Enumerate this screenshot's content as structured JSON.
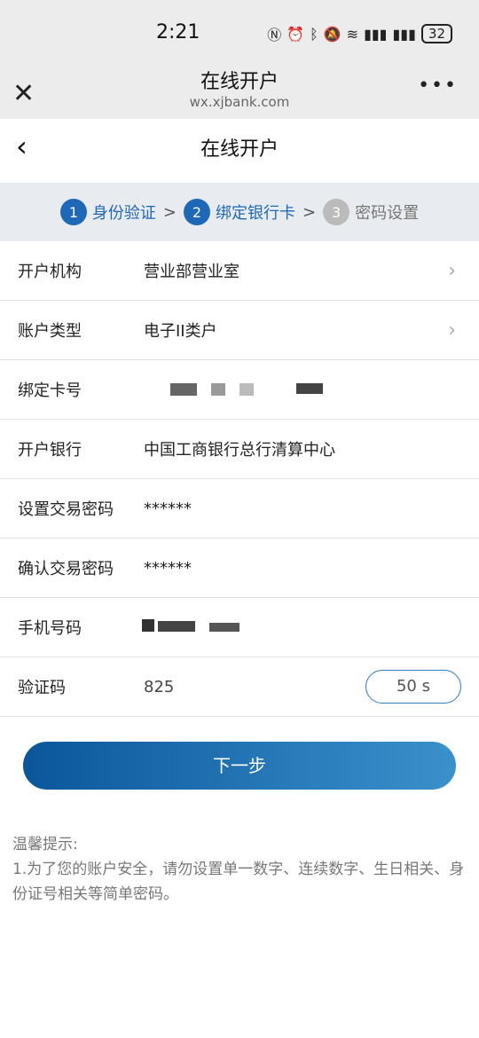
{
  "status": {
    "time": "2:21",
    "battery": "32"
  },
  "browser": {
    "title": "在线开户",
    "url": "wx.xjbank.com"
  },
  "page": {
    "title": "在线开户"
  },
  "steps": [
    {
      "num": "1",
      "label": "身份验证"
    },
    {
      "num": "2",
      "label": "绑定银行卡"
    },
    {
      "num": "3",
      "label": "密码设置"
    }
  ],
  "step_sep": ">",
  "form": {
    "institution": {
      "label": "开户机构",
      "value": "营业部营业室"
    },
    "account_type": {
      "label": "账户类型",
      "value": "电子II类户"
    },
    "card_no": {
      "label": "绑定卡号"
    },
    "bank": {
      "label": "开户银行",
      "value": "中国工商银行总行清算中心"
    },
    "trade_pwd": {
      "label": "设置交易密码",
      "value": "******"
    },
    "confirm_pwd": {
      "label": "确认交易密码",
      "value": "******"
    },
    "phone": {
      "label": "手机号码"
    },
    "code": {
      "label": "验证码",
      "value": "825",
      "countdown": "50 s"
    }
  },
  "next_button": "下一步",
  "tips": {
    "title": "温馨提示:",
    "text": "1.为了您的账户安全，请勿设置单一数字、连续数字、生日相关、身份证号相关等简单密码。"
  },
  "colors": {
    "accent": "#1e69b7",
    "button_start": "#0b569b",
    "button_end": "#3b91cc"
  }
}
